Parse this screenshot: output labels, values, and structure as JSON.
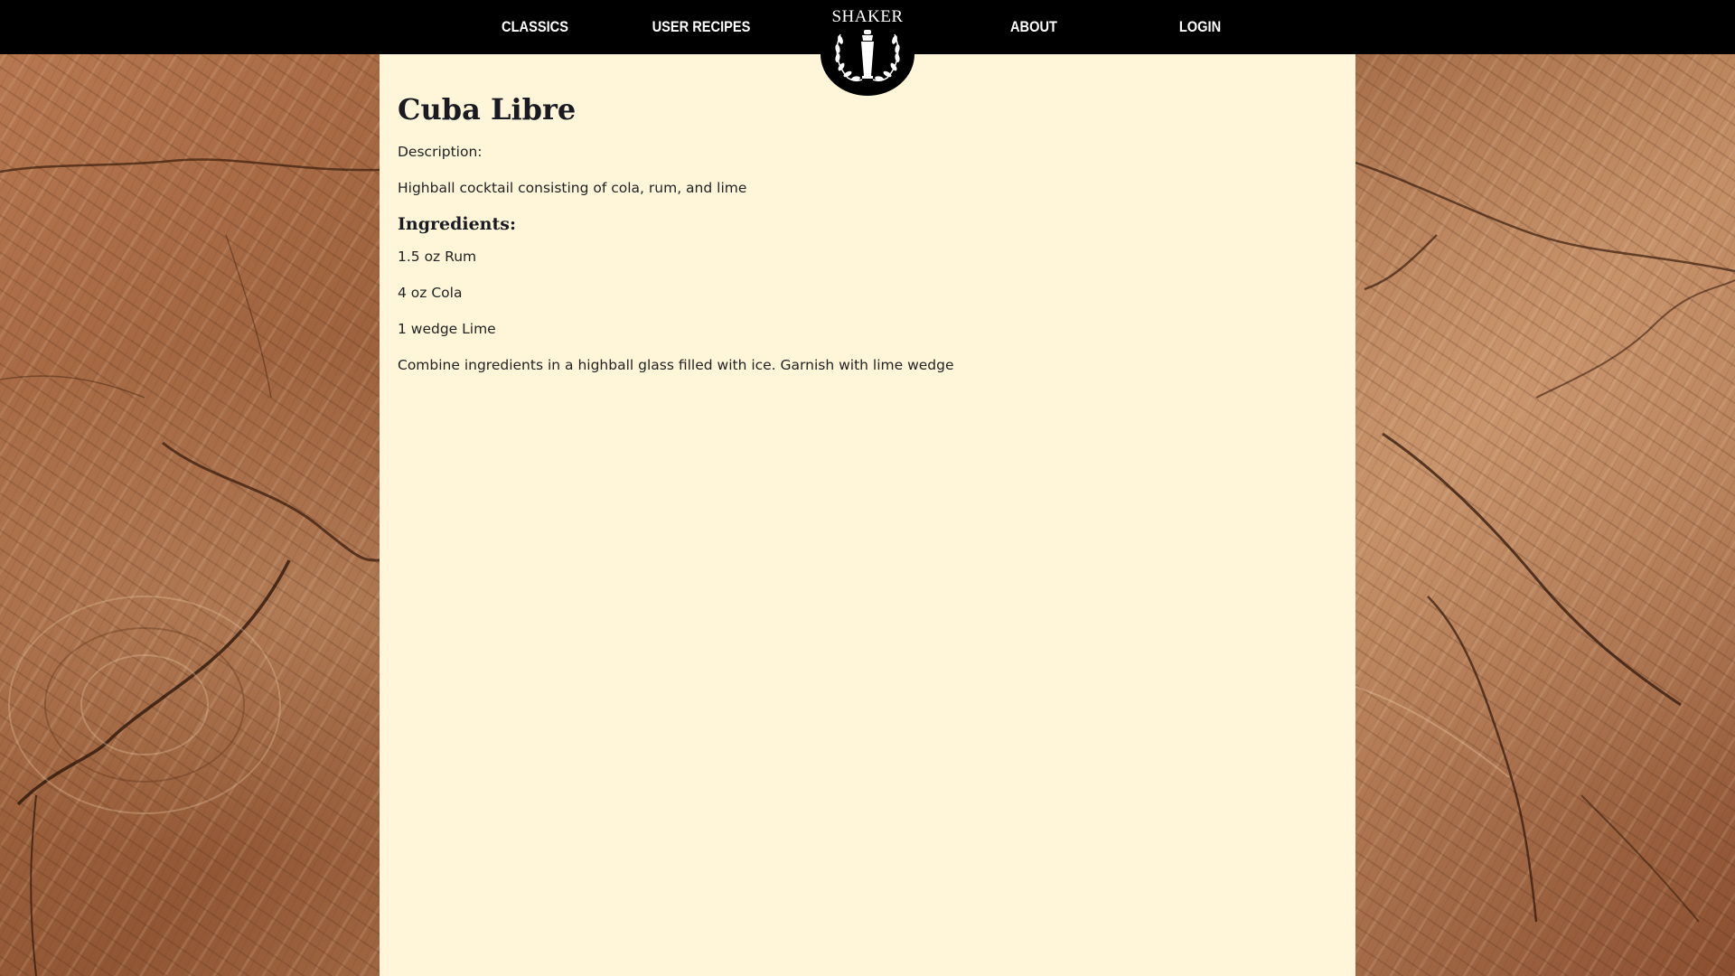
{
  "nav": {
    "items": [
      {
        "label": "CLASSICS"
      },
      {
        "label": "USER RECIPES"
      },
      {
        "label": "ABOUT"
      },
      {
        "label": "LOGIN"
      }
    ],
    "logo_text": "SHAKER"
  },
  "recipe": {
    "title": "Cuba Libre",
    "description_label": "Description:",
    "description": "Highball cocktail consisting of cola, rum, and lime",
    "ingredients_heading": "Ingredients:",
    "ingredients": [
      "1.5 oz Rum",
      "4 oz Cola",
      "1 wedge Lime"
    ],
    "instructions": "Combine ingredients in a highball glass filled with ice. Garnish with lime wedge"
  },
  "colors": {
    "nav_background": "#000000",
    "nav_text": "#ffffff",
    "content_background": "#fff6da",
    "wood_background": "#a86a45"
  },
  "icons": {
    "logo": "cocktail-shaker-laurel-icon"
  }
}
